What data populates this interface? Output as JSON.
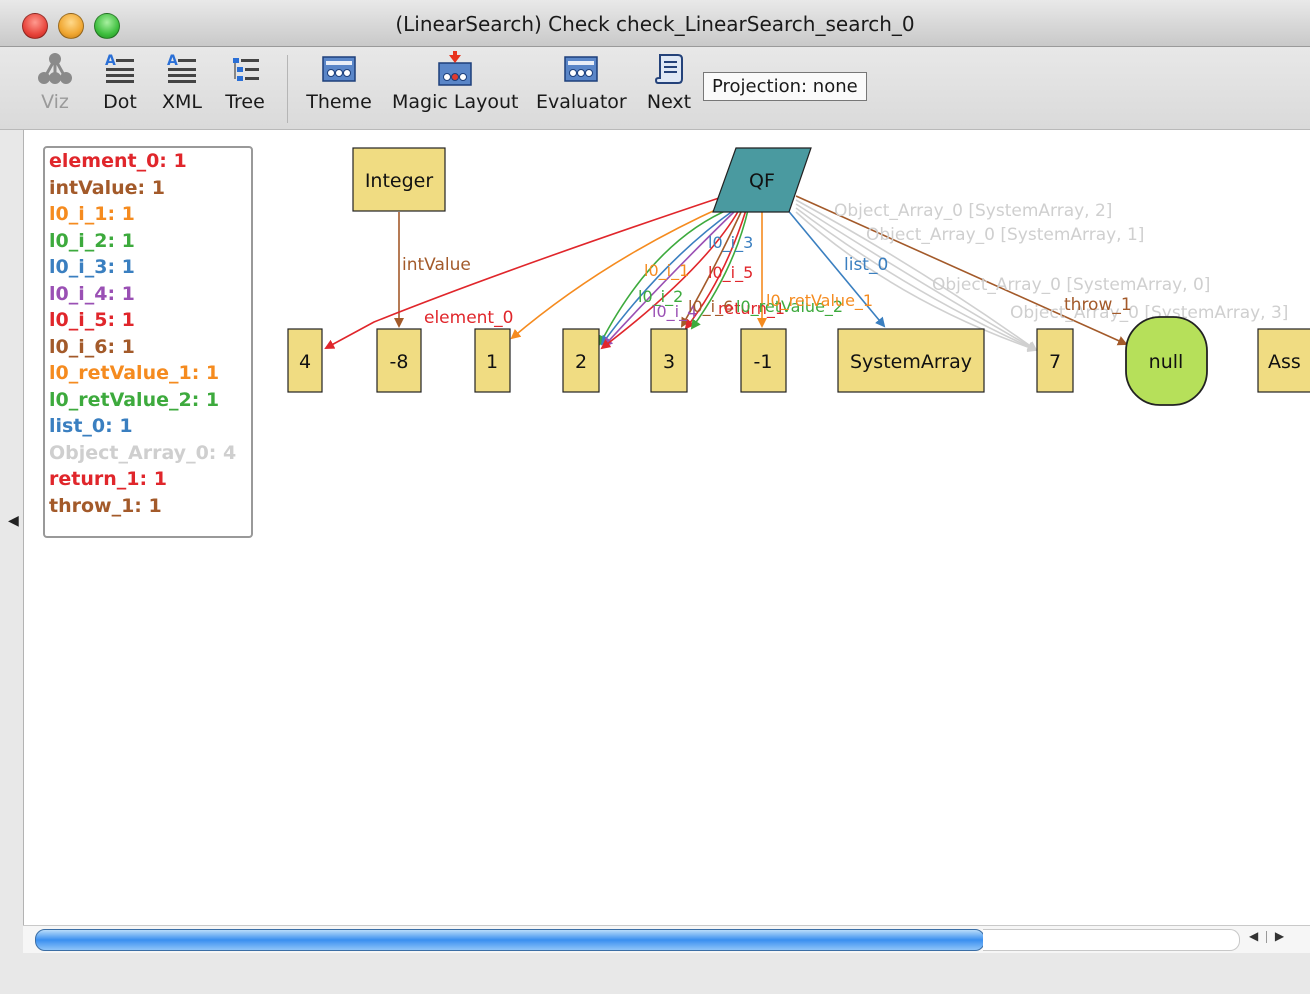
{
  "window": {
    "title": "(LinearSearch) Check check_LinearSearch_search_0",
    "controls": {
      "close": "#e8453c",
      "minimize": "#f0a732",
      "zoom": "#3fbf3f"
    }
  },
  "toolbar": {
    "buttons": [
      {
        "label": "Viz",
        "icon": "viz-tree-icon",
        "enabled": false
      },
      {
        "label": "Dot",
        "icon": "dot-text-icon",
        "enabled": true
      },
      {
        "label": "XML",
        "icon": "xml-text-icon",
        "enabled": true
      },
      {
        "label": "Tree",
        "icon": "tree-list-icon",
        "enabled": true
      },
      {
        "label": "Theme",
        "icon": "theme-palette-icon",
        "enabled": true
      },
      {
        "label": "Magic Layout",
        "icon": "magic-layout-icon",
        "enabled": true
      },
      {
        "label": "Evaluator",
        "icon": "evaluator-icon",
        "enabled": true
      },
      {
        "label": "Next",
        "icon": "next-scroll-icon",
        "enabled": true
      }
    ],
    "projection": "Projection: none"
  },
  "legend": [
    {
      "text": "element_0: 1",
      "color": "#e0262b"
    },
    {
      "text": "intValue: 1",
      "color": "#a35a2a"
    },
    {
      "text": "l0_i_1: 1",
      "color": "#f58b1f"
    },
    {
      "text": "l0_i_2: 1",
      "color": "#3daa3d"
    },
    {
      "text": "l0_i_3: 1",
      "color": "#3a7fc0"
    },
    {
      "text": "l0_i_4: 1",
      "color": "#9a50b4"
    },
    {
      "text": "l0_i_5: 1",
      "color": "#e0262b"
    },
    {
      "text": "l0_i_6: 1",
      "color": "#a35a2a"
    },
    {
      "text": "l0_retValue_1: 1",
      "color": "#f58b1f"
    },
    {
      "text": "l0_retValue_2: 1",
      "color": "#3daa3d"
    },
    {
      "text": "list_0: 1",
      "color": "#3a7fc0"
    },
    {
      "text": "Object_Array_0: 4",
      "color": "#cfcfcf"
    },
    {
      "text": "return_1: 1",
      "color": "#e0262b"
    },
    {
      "text": "throw_1: 1",
      "color": "#a35a2a"
    }
  ],
  "graph": {
    "nodes": {
      "integer": "Integer",
      "qf": "QF",
      "n4": "4",
      "n_8": "-8",
      "n1": "1",
      "n2": "2",
      "n3": "3",
      "n_1": "-1",
      "systemarray": "SystemArray",
      "n7": "7",
      "null": "null",
      "ass": "Ass"
    },
    "edge_labels": {
      "intValue": "intValue",
      "element_0": "element_0",
      "l0_i_3": "l0_i_3",
      "l0_i_1": "l0_i_1",
      "l0_i_5": "l0_i_5",
      "l0_i_2": "l0_i_2",
      "l0_i_4": "l0_i_4",
      "l0_i_6": "l0_i_6",
      "return_1": "return_1",
      "l0_retValue_1": "l0_retValue_1",
      "l0_retValue_2": "l0_retValue_2",
      "list_0": "list_0",
      "throw_1": "throw_1",
      "obj_2": "Object_Array_0 [SystemArray, 2]",
      "obj_1": "Object_Array_0 [SystemArray, 1]",
      "obj_0": "Object_Array_0 [SystemArray, 0]",
      "obj_3": "Object_Array_0 [SystemArray, 3]"
    },
    "colors": {
      "node_fill": "#f0dc82",
      "qf_fill": "#4a9aa0",
      "null_fill": "#b6e05a"
    }
  }
}
